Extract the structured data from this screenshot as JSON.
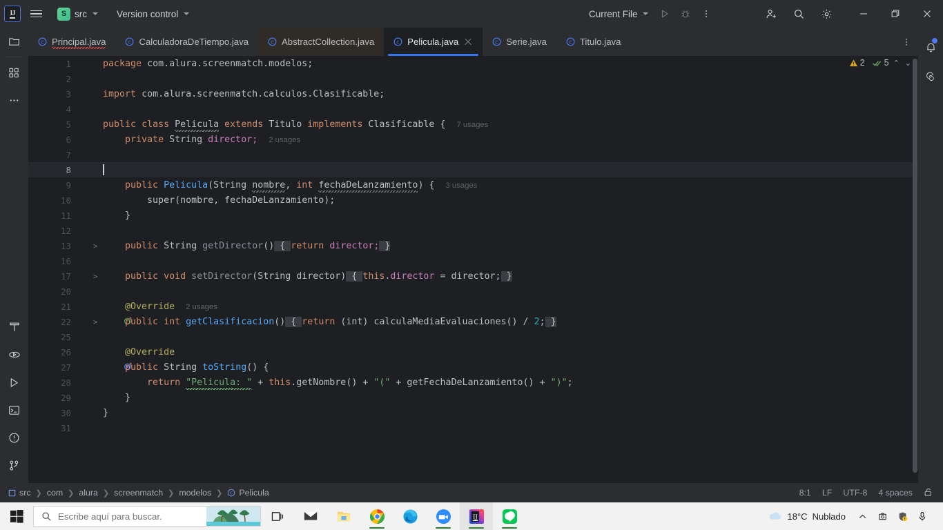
{
  "titlebar": {
    "logo_text": "IJ",
    "project_badge": "S",
    "project_name": "src",
    "vcs_label": "Version control",
    "run_config": "Current File",
    "icons": {
      "menu": "hamburger-icon",
      "run": "run-icon",
      "debug": "debug-icon",
      "more": "more-options-icon",
      "invite": "add-collaborator-icon",
      "search": "search-icon",
      "settings": "gear-icon",
      "minimize": "minimize-icon",
      "maximize": "maximize-icon",
      "close": "close-icon"
    }
  },
  "left_rail": {
    "items": [
      {
        "name": "project-tool-window",
        "icon": "folder-icon"
      },
      {
        "name": "structure-tool-window",
        "icon": "blocks-icon"
      },
      {
        "name": "more-tool-windows",
        "icon": "ellipsis-icon"
      },
      {
        "name": "build-tool-window",
        "icon": "hammer-icon"
      },
      {
        "name": "run-dashboard",
        "icon": "play-circle-icon"
      },
      {
        "name": "run-tool-window",
        "icon": "play-icon"
      },
      {
        "name": "terminal-tool-window",
        "icon": "terminal-icon"
      },
      {
        "name": "problems-tool-window",
        "icon": "warning-circle-icon"
      },
      {
        "name": "version-control-tool-window",
        "icon": "branch-icon"
      }
    ]
  },
  "right_rail": {
    "items": [
      {
        "name": "notifications",
        "icon": "bell-icon",
        "badge": true
      },
      {
        "name": "ai-assistant",
        "icon": "spiral-icon",
        "badge": false
      }
    ]
  },
  "tabs": [
    {
      "label": "Principal.java",
      "icon": "java-class-icon",
      "state": "error",
      "selected": false,
      "tinted": false
    },
    {
      "label": "CalculadoraDeTiempo.java",
      "icon": "java-class-icon",
      "state": "normal",
      "selected": false,
      "tinted": false
    },
    {
      "label": "AbstractCollection.java",
      "icon": "java-class-icon",
      "state": "normal",
      "selected": false,
      "tinted": true
    },
    {
      "label": "Pelicula.java",
      "icon": "java-class-icon",
      "state": "normal",
      "selected": true,
      "tinted": false
    },
    {
      "label": "Serie.java",
      "icon": "java-class-icon",
      "state": "normal",
      "selected": false,
      "tinted": false
    },
    {
      "label": "Titulo.java",
      "icon": "java-class-icon",
      "state": "normal",
      "selected": false,
      "tinted": false
    }
  ],
  "inspection": {
    "warning_count": "2",
    "ok_count": "5",
    "warning_color": "#d9a520",
    "ok_color": "#5fa85f"
  },
  "editor": {
    "caret_line_number": "8",
    "lines": [
      {
        "num": "1",
        "fold": "",
        "mark": ""
      },
      {
        "num": "2",
        "fold": "",
        "mark": ""
      },
      {
        "num": "3",
        "fold": "",
        "mark": ""
      },
      {
        "num": "4",
        "fold": "",
        "mark": ""
      },
      {
        "num": "5",
        "fold": "",
        "mark": "",
        "usages": "7 usages"
      },
      {
        "num": "6",
        "fold": "",
        "mark": "",
        "usages": "2 usages"
      },
      {
        "num": "7",
        "fold": "",
        "mark": ""
      },
      {
        "num": "8",
        "fold": "",
        "mark": "",
        "current": true
      },
      {
        "num": "9",
        "fold": "",
        "mark": "",
        "usages": "3 usages"
      },
      {
        "num": "10",
        "fold": "",
        "mark": ""
      },
      {
        "num": "11",
        "fold": "",
        "mark": ""
      },
      {
        "num": "12",
        "fold": "",
        "mark": ""
      },
      {
        "num": "13",
        "fold": ">",
        "mark": ""
      },
      {
        "num": "16",
        "fold": "",
        "mark": ""
      },
      {
        "num": "17",
        "fold": ">",
        "mark": ""
      },
      {
        "num": "20",
        "fold": "",
        "mark": ""
      },
      {
        "num": "21",
        "fold": "",
        "mark": "",
        "usages": "2 usages"
      },
      {
        "num": "22",
        "fold": ">",
        "mark": "implements-icon"
      },
      {
        "num": "25",
        "fold": "",
        "mark": ""
      },
      {
        "num": "26",
        "fold": "",
        "mark": ""
      },
      {
        "num": "27",
        "fold": "",
        "mark": "overrides-icon"
      },
      {
        "num": "28",
        "fold": "",
        "mark": ""
      },
      {
        "num": "29",
        "fold": "",
        "mark": ""
      },
      {
        "num": "30",
        "fold": "",
        "mark": ""
      },
      {
        "num": "31",
        "fold": "",
        "mark": ""
      }
    ],
    "code": {
      "l1_package": "package",
      "l1_name": "com.alura.screenmatch.modelos;",
      "l3_import": "import",
      "l3_name": "com.alura.screenmatch.calculos.Clasificable;",
      "l5": {
        "public": "public",
        "class": "class",
        "name": "Pelicula",
        "extends": "extends",
        "super": "Titulo",
        "implements": "implements",
        "iface": "Clasificable",
        "brace": "{",
        "usages": "7 usages"
      },
      "l6": {
        "private": "private",
        "type": "String",
        "field": "director;",
        "usages": "2 usages"
      },
      "l9": {
        "public": "public",
        "ctor": "Pelicula",
        "open": "(",
        "t1": "String",
        "p1": "nombre",
        "comma": ", ",
        "t2": "int",
        "p2": "fechaDeLanzamiento",
        "close": ") {",
        "usages": "3 usages"
      },
      "l10": {
        "call": "super(nombre, fechaDeLanzamiento);"
      },
      "l11": {
        "brace": "}"
      },
      "l13": {
        "public": "public",
        "type": "String",
        "mth": "getDirector",
        "paren": "()",
        "b1": "{",
        "return": "return",
        "val": "director;",
        "b2": "}"
      },
      "l17": {
        "public": "public",
        "type": "void",
        "mth": "setDirector",
        "sig": "(String director)",
        "b1": "{",
        "this": "this",
        "dot": ".",
        "fld": "director",
        "eq": " = director;",
        "b2": "}"
      },
      "l21": {
        "ann": "@Override",
        "usages": "2 usages"
      },
      "l22": {
        "public": "public",
        "type": "int",
        "mth": "getClasificacion",
        "paren": "()",
        "b1": "{",
        "return": "return",
        "cast": "(int)",
        "call": " calculaMediaEvaluaciones() / ",
        "num": "2",
        "semi": ";",
        "b2": "}"
      },
      "l26": {
        "ann": "@Override"
      },
      "l27": {
        "public": "public",
        "type": "String",
        "mth": "toString",
        "tail": "() {"
      },
      "l28": {
        "return": "return",
        "s1": "\"Pelicula: \"",
        "plus1": " + ",
        "this": "this",
        "dot": ".",
        "m1": "getNombre()",
        "plus2": " + ",
        "s2": "\"(\"",
        "plus3": " + ",
        "m2": "getFechaDeLanzamiento()",
        "plus4": " + ",
        "s3": "\")\"",
        "semi": ";"
      },
      "l29": {
        "brace": "}"
      },
      "l30": {
        "brace": "}"
      }
    }
  },
  "statusbar": {
    "breadcrumbs": [
      {
        "label": "src",
        "icon": "module-icon"
      },
      {
        "label": "com",
        "icon": ""
      },
      {
        "label": "alura",
        "icon": ""
      },
      {
        "label": "screenmatch",
        "icon": ""
      },
      {
        "label": "modelos",
        "icon": ""
      },
      {
        "label": "Pelicula",
        "icon": "java-class-icon"
      }
    ],
    "caret_position": "8:1",
    "line_separator": "LF",
    "encoding": "UTF-8",
    "indent": "4 spaces",
    "lock_icon": "unlocked-icon"
  },
  "taskbar": {
    "start_icon": "windows-start-icon",
    "search_placeholder": "Escribe aquí para buscar.",
    "search_value": "",
    "search_icon": "magnifier-icon",
    "apps": [
      {
        "name": "task-view",
        "icon": "task-view-icon",
        "running": false,
        "active": false
      },
      {
        "name": "mail",
        "icon": "mail-icon",
        "running": false,
        "active": false
      },
      {
        "name": "file-explorer",
        "icon": "folder-icon",
        "running": false,
        "active": false
      },
      {
        "name": "google-chrome",
        "icon": "chrome-icon",
        "running": true,
        "active": false
      },
      {
        "name": "microsoft-edge",
        "icon": "edge-icon",
        "running": false,
        "active": false
      },
      {
        "name": "zoom",
        "icon": "zoom-icon",
        "running": true,
        "active": false
      },
      {
        "name": "intellij-idea",
        "icon": "intellij-icon",
        "running": true,
        "active": true
      },
      {
        "name": "line",
        "icon": "line-icon",
        "running": true,
        "active": false
      }
    ],
    "weather_temp": "18°C",
    "weather_desc": "Nublado",
    "tray": [
      {
        "name": "show-hidden-icons",
        "icon": "chevron-up-icon"
      },
      {
        "name": "screen-capture",
        "icon": "capture-icon"
      },
      {
        "name": "security-alert",
        "icon": "shield-warning-icon"
      },
      {
        "name": "microphone",
        "icon": "microphone-icon"
      }
    ]
  }
}
